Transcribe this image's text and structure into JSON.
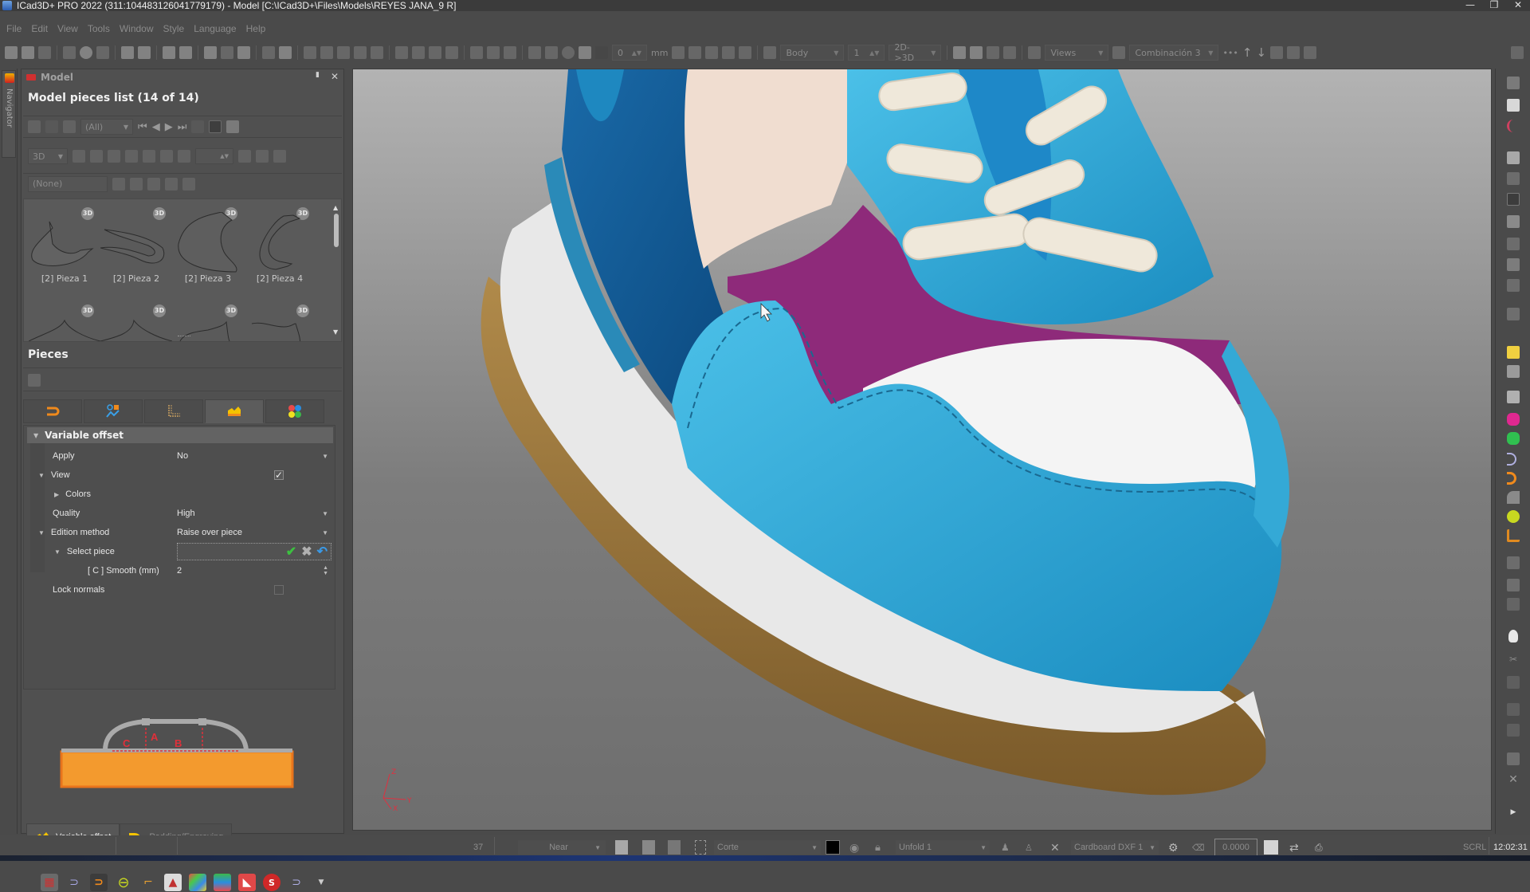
{
  "window": {
    "title": "ICad3D+ PRO 2022 (311:104483126041779179) - Model [C:\\ICad3D+\\Files\\Models\\REYES JANA_9 R]",
    "minimize": "—",
    "restore": "❐",
    "close": "✕"
  },
  "menu": [
    "File",
    "Edit",
    "View",
    "Tools",
    "Window",
    "Style",
    "Language",
    "Help"
  ],
  "toolbar": {
    "thickness_value": "0",
    "units_label": "mm",
    "body_select": "Body",
    "body_count": "1",
    "mode_select": "2D->3D",
    "views_select": "Views",
    "combination_select": "Combinación 3"
  },
  "navigator": {
    "label": "Navigator"
  },
  "model_panel": {
    "header": "Model",
    "pin": "📌",
    "close": "✕",
    "list_title": "Model pieces list (14 of 14)",
    "filter_select": "(All)",
    "view_select": "3D",
    "group_select": "(None)",
    "pieces": [
      {
        "label": "[2] Pieza 1",
        "badge": "3D"
      },
      {
        "label": "[2] Pieza 2",
        "badge": "3D"
      },
      {
        "label": "[2] Pieza 3",
        "badge": "3D"
      },
      {
        "label": "[2] Pieza 4",
        "badge": "3D"
      },
      {
        "label": "",
        "badge": "3D"
      },
      {
        "label": "",
        "badge": "3D"
      },
      {
        "label": "",
        "badge": "3D"
      },
      {
        "label": "",
        "badge": "3D"
      }
    ]
  },
  "pieces_section": {
    "title": "Pieces",
    "tabs": [
      "tab-trim",
      "tab-mark-lines",
      "tab-stitching",
      "tab-variable-offset",
      "tab-colors"
    ]
  },
  "variable_offset": {
    "header": "Variable offset",
    "rows": {
      "apply": {
        "label": "Apply",
        "value": "No"
      },
      "view": {
        "label": "View",
        "checked": "✓"
      },
      "colors": {
        "label": "Colors"
      },
      "quality": {
        "label": "Quality",
        "value": "High"
      },
      "edition_method": {
        "label": "Edition method",
        "value": "Raise over piece"
      },
      "select_piece": {
        "label": "Select piece",
        "value": ""
      },
      "smooth": {
        "label": "[ C ] Smooth (mm)",
        "value": "2"
      },
      "lock_normals": {
        "label": "Lock normals",
        "checked": ""
      }
    },
    "diagram_labels": {
      "a": "A",
      "b": "B",
      "c": "C"
    }
  },
  "bottom_tabs": [
    {
      "label": "Variable offset",
      "active": true
    },
    {
      "label": "Padding/Engraving",
      "active": false
    }
  ],
  "viewport": {
    "axis": {
      "x": "X",
      "y": "Y",
      "z": "Z"
    }
  },
  "statusbar": {
    "zoom_value": "37",
    "clip_select": "Near",
    "cut_select": "Corte",
    "unfold_select": "Unfold 1",
    "export_select": "Cardboard DXF 1",
    "numeric_value": "0.0000",
    "scroll_lock": "SCRL",
    "clock": "12:02:31"
  },
  "colors": {
    "accent_orange": "#f39a2e",
    "diagram_red": "#e0303a",
    "shoe_blue": "#34a9d6",
    "shoe_purple": "#8e2a7a",
    "sole_brown": "#9a7a40"
  }
}
